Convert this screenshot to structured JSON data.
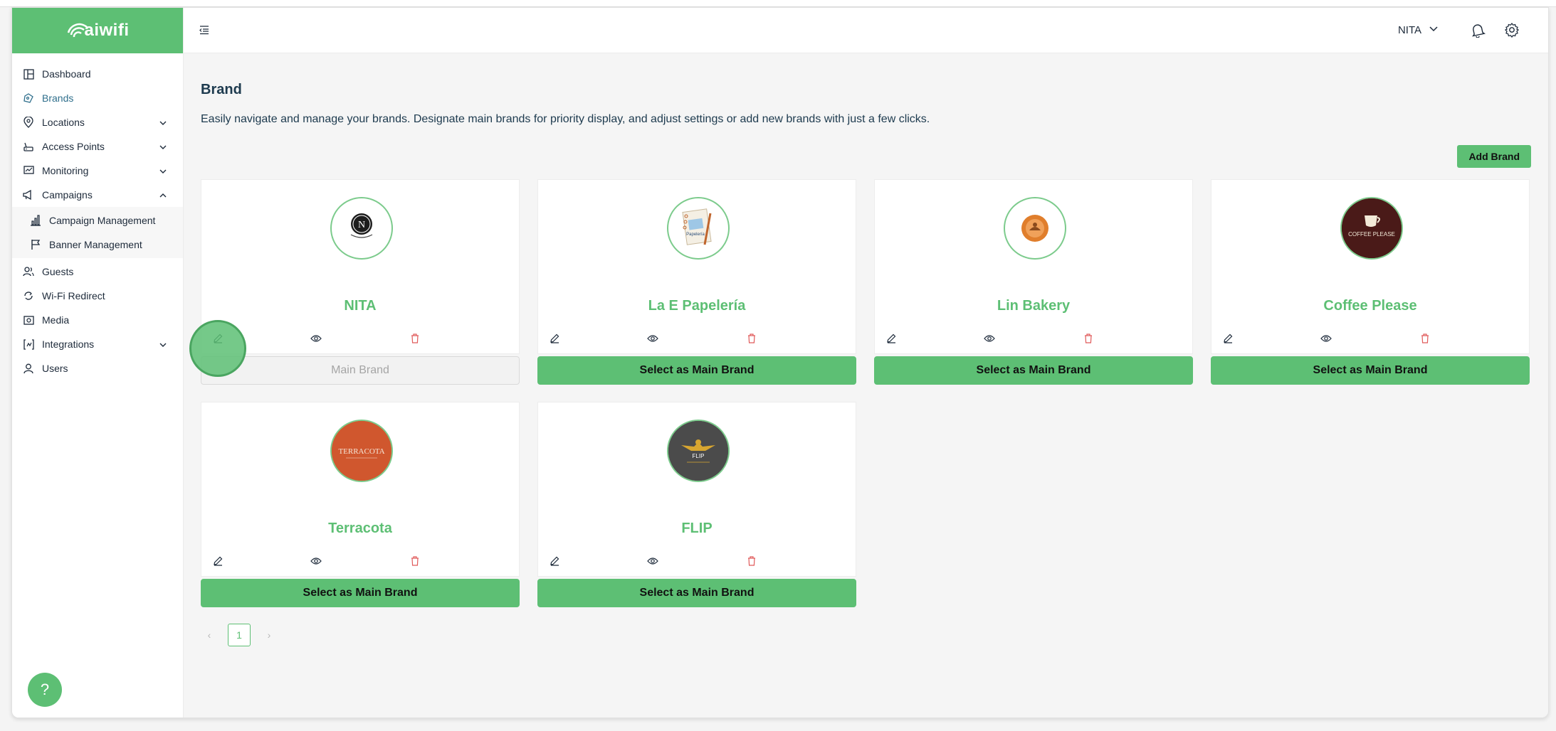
{
  "app": {
    "logo_text": "aiwifi"
  },
  "sidebar": {
    "items": [
      {
        "label": "Dashboard",
        "icon": "dashboard-icon"
      },
      {
        "label": "Brands",
        "icon": "brands-icon",
        "active": true
      },
      {
        "label": "Locations",
        "icon": "location-pin-icon",
        "expandable": true
      },
      {
        "label": "Access Points",
        "icon": "router-icon",
        "expandable": true
      },
      {
        "label": "Monitoring",
        "icon": "monitor-icon",
        "expandable": true
      },
      {
        "label": "Campaigns",
        "icon": "megaphone-icon",
        "expandable": true,
        "expanded": true
      }
    ],
    "sub_items": [
      {
        "label": "Campaign Management",
        "icon": "bar-chart-icon"
      },
      {
        "label": "Banner Management",
        "icon": "flag-icon"
      }
    ],
    "items_after": [
      {
        "label": "Guests",
        "icon": "users-icon"
      },
      {
        "label": "Wi-Fi Redirect",
        "icon": "redirect-icon"
      },
      {
        "label": "Media",
        "icon": "image-icon"
      },
      {
        "label": "Integrations",
        "icon": "integrations-icon",
        "expandable": true
      },
      {
        "label": "Users",
        "icon": "user-icon"
      }
    ]
  },
  "header": {
    "account_name": "NITA"
  },
  "page": {
    "title": "Brand",
    "description": "Easily navigate and manage your brands. Designate main brands for priority display, and adjust settings or add new brands with just a few clicks.",
    "add_button": "Add Brand"
  },
  "brands": [
    {
      "name": "NITA",
      "button": "Main Brand",
      "is_main": true
    },
    {
      "name": "La E Papelería",
      "button": "Select as Main Brand",
      "is_main": false
    },
    {
      "name": "Lin Bakery",
      "button": "Select as Main Brand",
      "is_main": false
    },
    {
      "name": "Coffee Please",
      "button": "Select as Main Brand",
      "is_main": false
    },
    {
      "name": "Terracota",
      "button": "Select as Main Brand",
      "is_main": false
    },
    {
      "name": "FLIP",
      "button": "Select as Main Brand",
      "is_main": false
    }
  ],
  "logo_texts": {
    "nita": "N",
    "papeleria": "Papelería",
    "coffee": "COFFEE PLEASE",
    "terracota": "TERRACOTA",
    "flip": "FLIP"
  },
  "pagination": {
    "current": "1",
    "prev": "‹",
    "next": "›"
  },
  "help": {
    "label": "?"
  },
  "colors": {
    "accent": "#5dbf74",
    "delete": "#e05a5a",
    "text": "#1d3a4e"
  }
}
